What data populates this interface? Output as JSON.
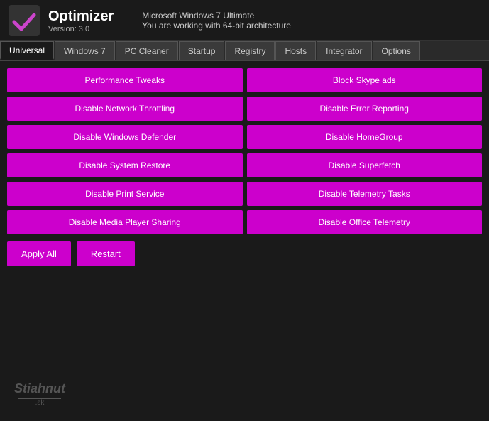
{
  "header": {
    "app_title": "Optimizer",
    "app_version": "Version: 3.0",
    "os_info": "Microsoft Windows 7 Ultimate",
    "arch_info": "You are working with 64-bit architecture"
  },
  "tabs": [
    {
      "label": "Universal",
      "active": true
    },
    {
      "label": "Windows 7",
      "active": false
    },
    {
      "label": "PC Cleaner",
      "active": false
    },
    {
      "label": "Startup",
      "active": false
    },
    {
      "label": "Registry",
      "active": false
    },
    {
      "label": "Hosts",
      "active": false
    },
    {
      "label": "Integrator",
      "active": false
    },
    {
      "label": "Options",
      "active": false
    }
  ],
  "section_label": "Performance Tweaks",
  "buttons": [
    {
      "label": "Performance Tweaks",
      "id": "perf-tweaks"
    },
    {
      "label": "Block Skype ads",
      "id": "block-skype"
    },
    {
      "label": "Disable Network Throttling",
      "id": "disable-net-throttle"
    },
    {
      "label": "Disable Error Reporting",
      "id": "disable-error-report"
    },
    {
      "label": "Disable Windows Defender",
      "id": "disable-defender"
    },
    {
      "label": "Disable HomeGroup",
      "id": "disable-homegroup"
    },
    {
      "label": "Disable System Restore",
      "id": "disable-sys-restore"
    },
    {
      "label": "Disable Superfetch",
      "id": "disable-superfetch"
    },
    {
      "label": "Disable Print Service",
      "id": "disable-print-svc"
    },
    {
      "label": "Disable Telemetry Tasks",
      "id": "disable-telemetry"
    },
    {
      "label": "Disable Media Player Sharing",
      "id": "disable-media-sharing"
    },
    {
      "label": "Disable Office Telemetry",
      "id": "disable-office-telemetry"
    }
  ],
  "action_buttons": [
    {
      "label": "Apply All",
      "id": "apply-all"
    },
    {
      "label": "Restart",
      "id": "restart"
    }
  ],
  "watermark": {
    "text": "Stiahnut",
    "sub": ".sk"
  }
}
